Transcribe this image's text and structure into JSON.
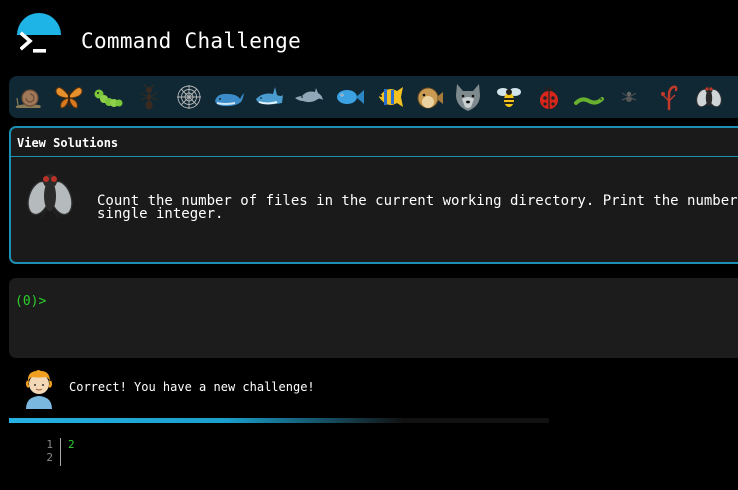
{
  "header": {
    "title": "Command Challenge",
    "accent_color": "#1fb4e6",
    "logo_icon": "terminal-prompt-icon"
  },
  "creature_strip": {
    "background": "#0f2833",
    "items": [
      {
        "name": "snail",
        "icon": "snail-icon"
      },
      {
        "name": "butterfly",
        "icon": "butterfly-icon"
      },
      {
        "name": "caterpillar",
        "icon": "caterpillar-icon"
      },
      {
        "name": "ant",
        "icon": "ant-icon"
      },
      {
        "name": "spider-web",
        "icon": "spider-web-icon"
      },
      {
        "name": "whale",
        "icon": "whale-icon"
      },
      {
        "name": "shark",
        "icon": "shark-icon"
      },
      {
        "name": "dolphin",
        "icon": "dolphin-icon"
      },
      {
        "name": "fish",
        "icon": "fish-icon"
      },
      {
        "name": "tropical-fish",
        "icon": "tropical-fish-icon"
      },
      {
        "name": "blowfish",
        "icon": "blowfish-icon"
      },
      {
        "name": "wolf",
        "icon": "wolf-icon"
      },
      {
        "name": "bee",
        "icon": "bee-icon"
      },
      {
        "name": "ladybug",
        "icon": "ladybug-icon"
      },
      {
        "name": "worm",
        "icon": "worm-icon"
      },
      {
        "name": "spider",
        "icon": "spider-icon"
      },
      {
        "name": "scorpion",
        "icon": "scorpion-icon"
      },
      {
        "name": "fly",
        "icon": "fly-icon"
      }
    ]
  },
  "challenge": {
    "view_solutions_label": "View Solutions",
    "icon": "fly-icon",
    "text_line1": "Count the number of files in the current working directory. Print the number as a",
    "text_line2": "single integer.",
    "border_color": "#1c8fb3"
  },
  "terminal": {
    "prompt": "(0)>",
    "prompt_color": "#2bd12b"
  },
  "feedback": {
    "avatar_icon": "person-avatar-icon",
    "message": "Correct! You have a new challenge!",
    "progress_percent": 73
  },
  "editor": {
    "line_numbers": [
      "1",
      "2"
    ],
    "lines": [
      "2",
      ""
    ]
  }
}
